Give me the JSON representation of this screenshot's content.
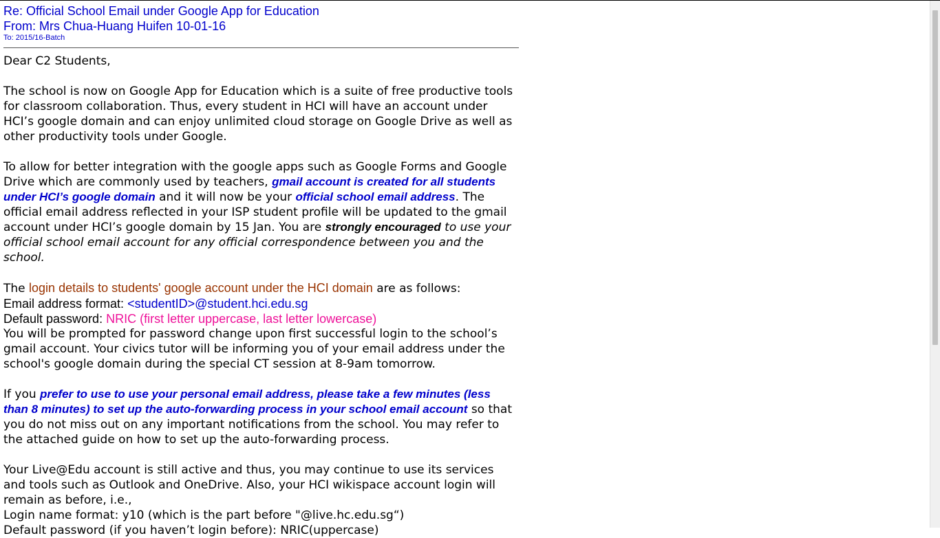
{
  "email": {
    "subject": "Re: Official School Email under Google App for Education",
    "from": "From: Mrs Chua-Huang Huifen 10-01-16",
    "to": "To: 2015/16-Batch"
  },
  "body": {
    "greeting": "Dear C2 Students,",
    "p1": "The school is now on Google App for Education which is a suite of free productive tools for classroom collaboration. Thus, every student in HCI will have an account under HCI’s google domain and can enjoy unlimited cloud storage on Google Drive as well as other productivity tools under Google.",
    "p2": {
      "t1": "To allow for better integration with the google apps such as Google Forms and Google Drive which are commonly used by teachers, ",
      "e1": "gmail account is created for all students under HCI’s google domain",
      "t2": " and it will now be your ",
      "e2": "official school email address",
      "t3": ". The official email address reflected in your ISP student profile will be updated to the gmail account under HCI’s google domain by 15 Jan. You are ",
      "e3": "strongly encouraged",
      "t4": " to use your official school email account for any official correspondence between you and the school."
    },
    "p3": {
      "t1": "The ",
      "e1": "login details to students' google account under the HCI domain",
      "t2": " are as follows:",
      "email_label": "Email address format: ",
      "email_value": "<studentID>@student.hci.edu.sg",
      "pw_label": "Default password: ",
      "pw_value": "NRIC (first letter uppercase, last letter lowercase)",
      "t3": "You will be prompted for password change upon first successful login to the school’s gmail account. Your civics tutor will be informing you of your email address under the school's google domain during the special CT session at 8-9am tomorrow."
    },
    "p4": {
      "t1": "If you ",
      "e1": "prefer to use to use your personal email address, please take a few minutes (less than 8 minutes) to set up the auto-forwarding process in your school email account",
      "t2": " so that you do not miss out on any important notifications from the school. You may refer to the attached guide on how to set up the auto-forwarding process."
    },
    "p5": {
      "t1": "Your Live@Edu account is still active and thus, you may continue to use its services and tools such as Outlook and OneDrive. Also, your HCI wikispace account login will remain as before, i.e.,",
      "line1": "Login name format: y10 (which is the part before \"@live.hc.edu.sg“)",
      "line2": "Default password (if you haven’t login before): NRIC(uppercase)"
    }
  },
  "colors": {
    "header_blue": "#0000cc",
    "brown": "#993300",
    "pink": "#ee1199"
  }
}
